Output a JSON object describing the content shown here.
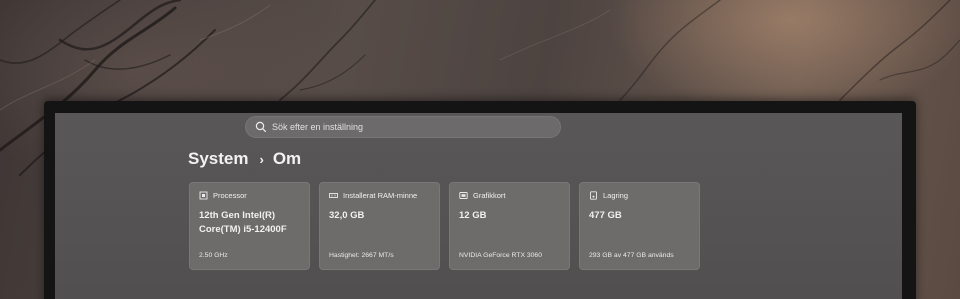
{
  "search": {
    "placeholder": "Sök efter en inställning"
  },
  "breadcrumb": {
    "parent": "System",
    "separator": "›",
    "current": "Om"
  },
  "cards": [
    {
      "icon": "processor-icon",
      "title": "Processor",
      "value": "12th Gen Intel(R) Core(TM) i5-12400F",
      "sub": "2.50 GHz"
    },
    {
      "icon": "ram-icon",
      "title": "Installerat RAM-minne",
      "value": "32,0 GB",
      "sub": "Hastighet: 2667 MT/s"
    },
    {
      "icon": "graphics-card-icon",
      "title": "Grafikkort",
      "value": "12 GB",
      "sub": "NVIDIA GeForce RTX 3060"
    },
    {
      "icon": "storage-icon",
      "title": "Lagring",
      "value": "477 GB",
      "sub": "293 GB av 477 GB används"
    }
  ],
  "colors": {
    "screen_background": "#565454",
    "card_background": "#6e6b6b",
    "text": "#f2f0f0"
  }
}
